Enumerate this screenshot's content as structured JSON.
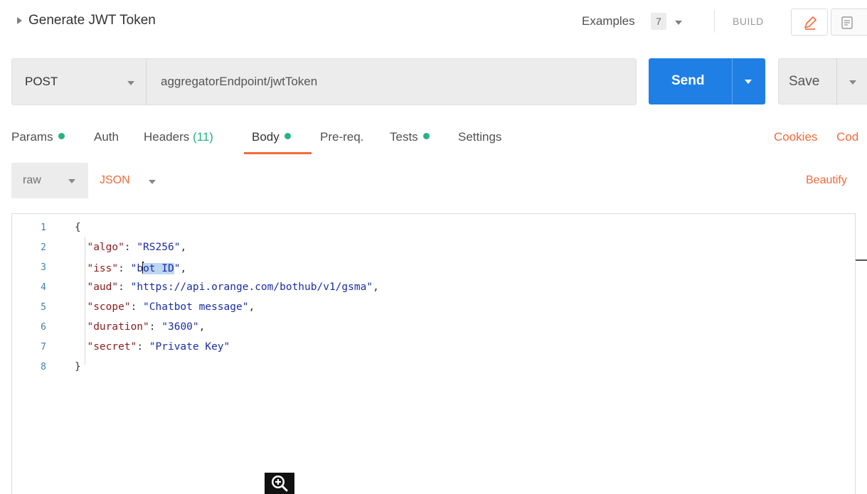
{
  "title": {
    "request_name": "Generate JWT Token",
    "examples_label": "Examples",
    "examples_count": "7",
    "build_label": "BUILD"
  },
  "request": {
    "method": "POST",
    "url": "aggregatorEndpoint/jwtToken",
    "send_label": "Send",
    "save_label": "Save"
  },
  "tabs": {
    "params": "Params",
    "auth": "Auth",
    "headers": "Headers",
    "headers_count": "(11)",
    "body": "Body",
    "prereq": "Pre-req.",
    "tests": "Tests",
    "settings": "Settings",
    "cookies": "Cookies",
    "code": "Cod"
  },
  "body_options": {
    "mode": "raw",
    "language": "JSON",
    "beautify": "Beautify"
  },
  "editor": {
    "line_numbers": [
      "1",
      "2",
      "3",
      "4",
      "5",
      "6",
      "7",
      "8"
    ],
    "lines": {
      "l1": "{",
      "l2_key": "\"algo\"",
      "l2_val": "\"RS256\"",
      "l3_key": "\"iss\"",
      "l3_val_a": "\"b",
      "l3_val_sel": "ot ID",
      "l3_val_b": "\"",
      "l4_key": "\"aud\"",
      "l4_val": "\"https://api.orange.com/bothub/v1/gsma\"",
      "l5_key": "\"scope\"",
      "l5_val": "\"Chatbot message\"",
      "l6_key": "\"duration\"",
      "l6_val": "\"3600\"",
      "l7_key": "\"secret\"",
      "l7_val": "\"Private Key\"",
      "l8": "}"
    }
  },
  "colors": {
    "accent_orange": "#f26b3a",
    "send_blue": "#1f7fe5",
    "status_green": "#26b47f"
  },
  "icons": [
    "caret-right-icon",
    "chevron-down-icon",
    "pencil-icon",
    "document-icon",
    "zoom-in-icon"
  ]
}
